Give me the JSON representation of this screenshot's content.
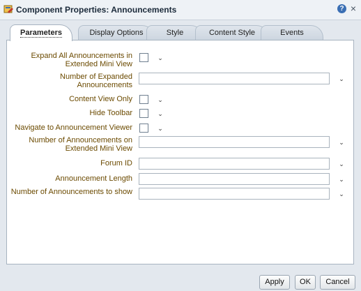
{
  "window": {
    "title": "Component Properties: Announcements",
    "help_glyph": "?",
    "close_glyph": "×"
  },
  "tabs": [
    {
      "label": "Parameters",
      "active": true
    },
    {
      "label": "Display Options",
      "active": false
    },
    {
      "label": "Style",
      "active": false
    },
    {
      "label": "Content Style",
      "active": false
    },
    {
      "label": "Events",
      "active": false
    }
  ],
  "fields": [
    {
      "label": "Expand All Announcements in Extended Mini View",
      "type": "checkbox",
      "checked": false
    },
    {
      "label": "Number of Expanded Announcements",
      "type": "text",
      "value": ""
    },
    {
      "label": "Content View Only",
      "type": "checkbox",
      "checked": false
    },
    {
      "label": "Hide Toolbar",
      "type": "checkbox",
      "checked": false
    },
    {
      "label": "Navigate to Announcement Viewer",
      "type": "checkbox",
      "checked": false
    },
    {
      "label": "Number of Announcements on Extended Mini View",
      "type": "text",
      "value": ""
    },
    {
      "label": "Forum ID",
      "type": "text",
      "value": ""
    },
    {
      "label": "Announcement Length",
      "type": "text",
      "value": ""
    },
    {
      "label": "Number of Announcements to show",
      "type": "text",
      "value": ""
    }
  ],
  "buttons": {
    "apply": "Apply",
    "ok": "OK",
    "cancel": "Cancel"
  },
  "icons": {
    "dropdown": "chevron-down-icon",
    "help": "help-icon",
    "close": "close-icon",
    "app": "component-icon"
  },
  "colors": {
    "label": "#6b4a00",
    "accent": "#3a6fb4"
  }
}
